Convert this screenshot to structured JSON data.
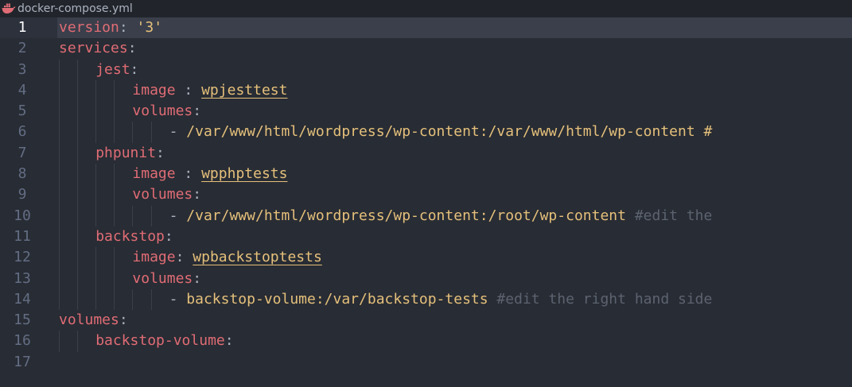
{
  "tab": {
    "filename": "docker-compose.yml",
    "icon": "docker-whale-icon",
    "icon_color": "#e06c75"
  },
  "colors": {
    "background": "#282c34",
    "key": "#e06c75",
    "string": "#e5c07b",
    "comment": "#5c6370",
    "gutter": "#636d83"
  },
  "editor": {
    "current_line": 1,
    "lines": [
      {
        "n": "1",
        "indent": 0,
        "parts": [
          {
            "t": "version",
            "c": "key"
          },
          {
            "t": ": ",
            "c": "punct"
          },
          {
            "t": "'3'",
            "c": "str"
          }
        ]
      },
      {
        "n": "2",
        "indent": 0,
        "parts": [
          {
            "t": "services",
            "c": "key"
          },
          {
            "t": ":",
            "c": "punct"
          }
        ]
      },
      {
        "n": "3",
        "indent": 4,
        "parts": [
          {
            "t": "jest",
            "c": "key"
          },
          {
            "t": ":",
            "c": "punct"
          }
        ]
      },
      {
        "n": "4",
        "indent": 8,
        "parts": [
          {
            "t": "image",
            "c": "key"
          },
          {
            "t": " : ",
            "c": "punct"
          },
          {
            "t": "wpjesttest",
            "c": "anchor"
          }
        ]
      },
      {
        "n": "5",
        "indent": 8,
        "parts": [
          {
            "t": "volumes",
            "c": "key"
          },
          {
            "t": ":",
            "c": "punct"
          }
        ]
      },
      {
        "n": "6",
        "indent": 12,
        "parts": [
          {
            "t": "- ",
            "c": "punct"
          },
          {
            "t": "/var/www/html/wordpress/wp-content:/var/www/html/wp-content #",
            "c": "str"
          }
        ]
      },
      {
        "n": "7",
        "indent": 4,
        "parts": [
          {
            "t": "phpunit",
            "c": "key"
          },
          {
            "t": ":",
            "c": "punct"
          }
        ]
      },
      {
        "n": "8",
        "indent": 8,
        "parts": [
          {
            "t": "image",
            "c": "key"
          },
          {
            "t": " : ",
            "c": "punct"
          },
          {
            "t": "wpphptests",
            "c": "anchor"
          }
        ]
      },
      {
        "n": "9",
        "indent": 8,
        "parts": [
          {
            "t": "volumes",
            "c": "key"
          },
          {
            "t": ":",
            "c": "punct"
          }
        ]
      },
      {
        "n": "10",
        "indent": 12,
        "parts": [
          {
            "t": "- ",
            "c": "punct"
          },
          {
            "t": "/var/www/html/wordpress/wp-content:/root/wp-content ",
            "c": "str"
          },
          {
            "t": "#edit the",
            "c": "comment"
          }
        ]
      },
      {
        "n": "11",
        "indent": 4,
        "parts": [
          {
            "t": "backstop",
            "c": "key"
          },
          {
            "t": ":",
            "c": "punct"
          }
        ]
      },
      {
        "n": "12",
        "indent": 8,
        "parts": [
          {
            "t": "image",
            "c": "key"
          },
          {
            "t": ": ",
            "c": "punct"
          },
          {
            "t": "wpbackstoptests",
            "c": "anchor"
          }
        ]
      },
      {
        "n": "13",
        "indent": 8,
        "parts": [
          {
            "t": "volumes",
            "c": "key"
          },
          {
            "t": ":",
            "c": "punct"
          }
        ]
      },
      {
        "n": "14",
        "indent": 12,
        "parts": [
          {
            "t": "- ",
            "c": "punct"
          },
          {
            "t": "backstop-volume:/var/backstop-tests ",
            "c": "str"
          },
          {
            "t": "#edit the right hand side",
            "c": "comment"
          }
        ]
      },
      {
        "n": "15",
        "indent": 0,
        "parts": [
          {
            "t": "volumes",
            "c": "key"
          },
          {
            "t": ":",
            "c": "punct"
          }
        ]
      },
      {
        "n": "16",
        "indent": 4,
        "parts": [
          {
            "t": "backstop-volume",
            "c": "key"
          },
          {
            "t": ":",
            "c": "punct"
          }
        ]
      },
      {
        "n": "17",
        "indent": 0,
        "parts": []
      }
    ]
  }
}
